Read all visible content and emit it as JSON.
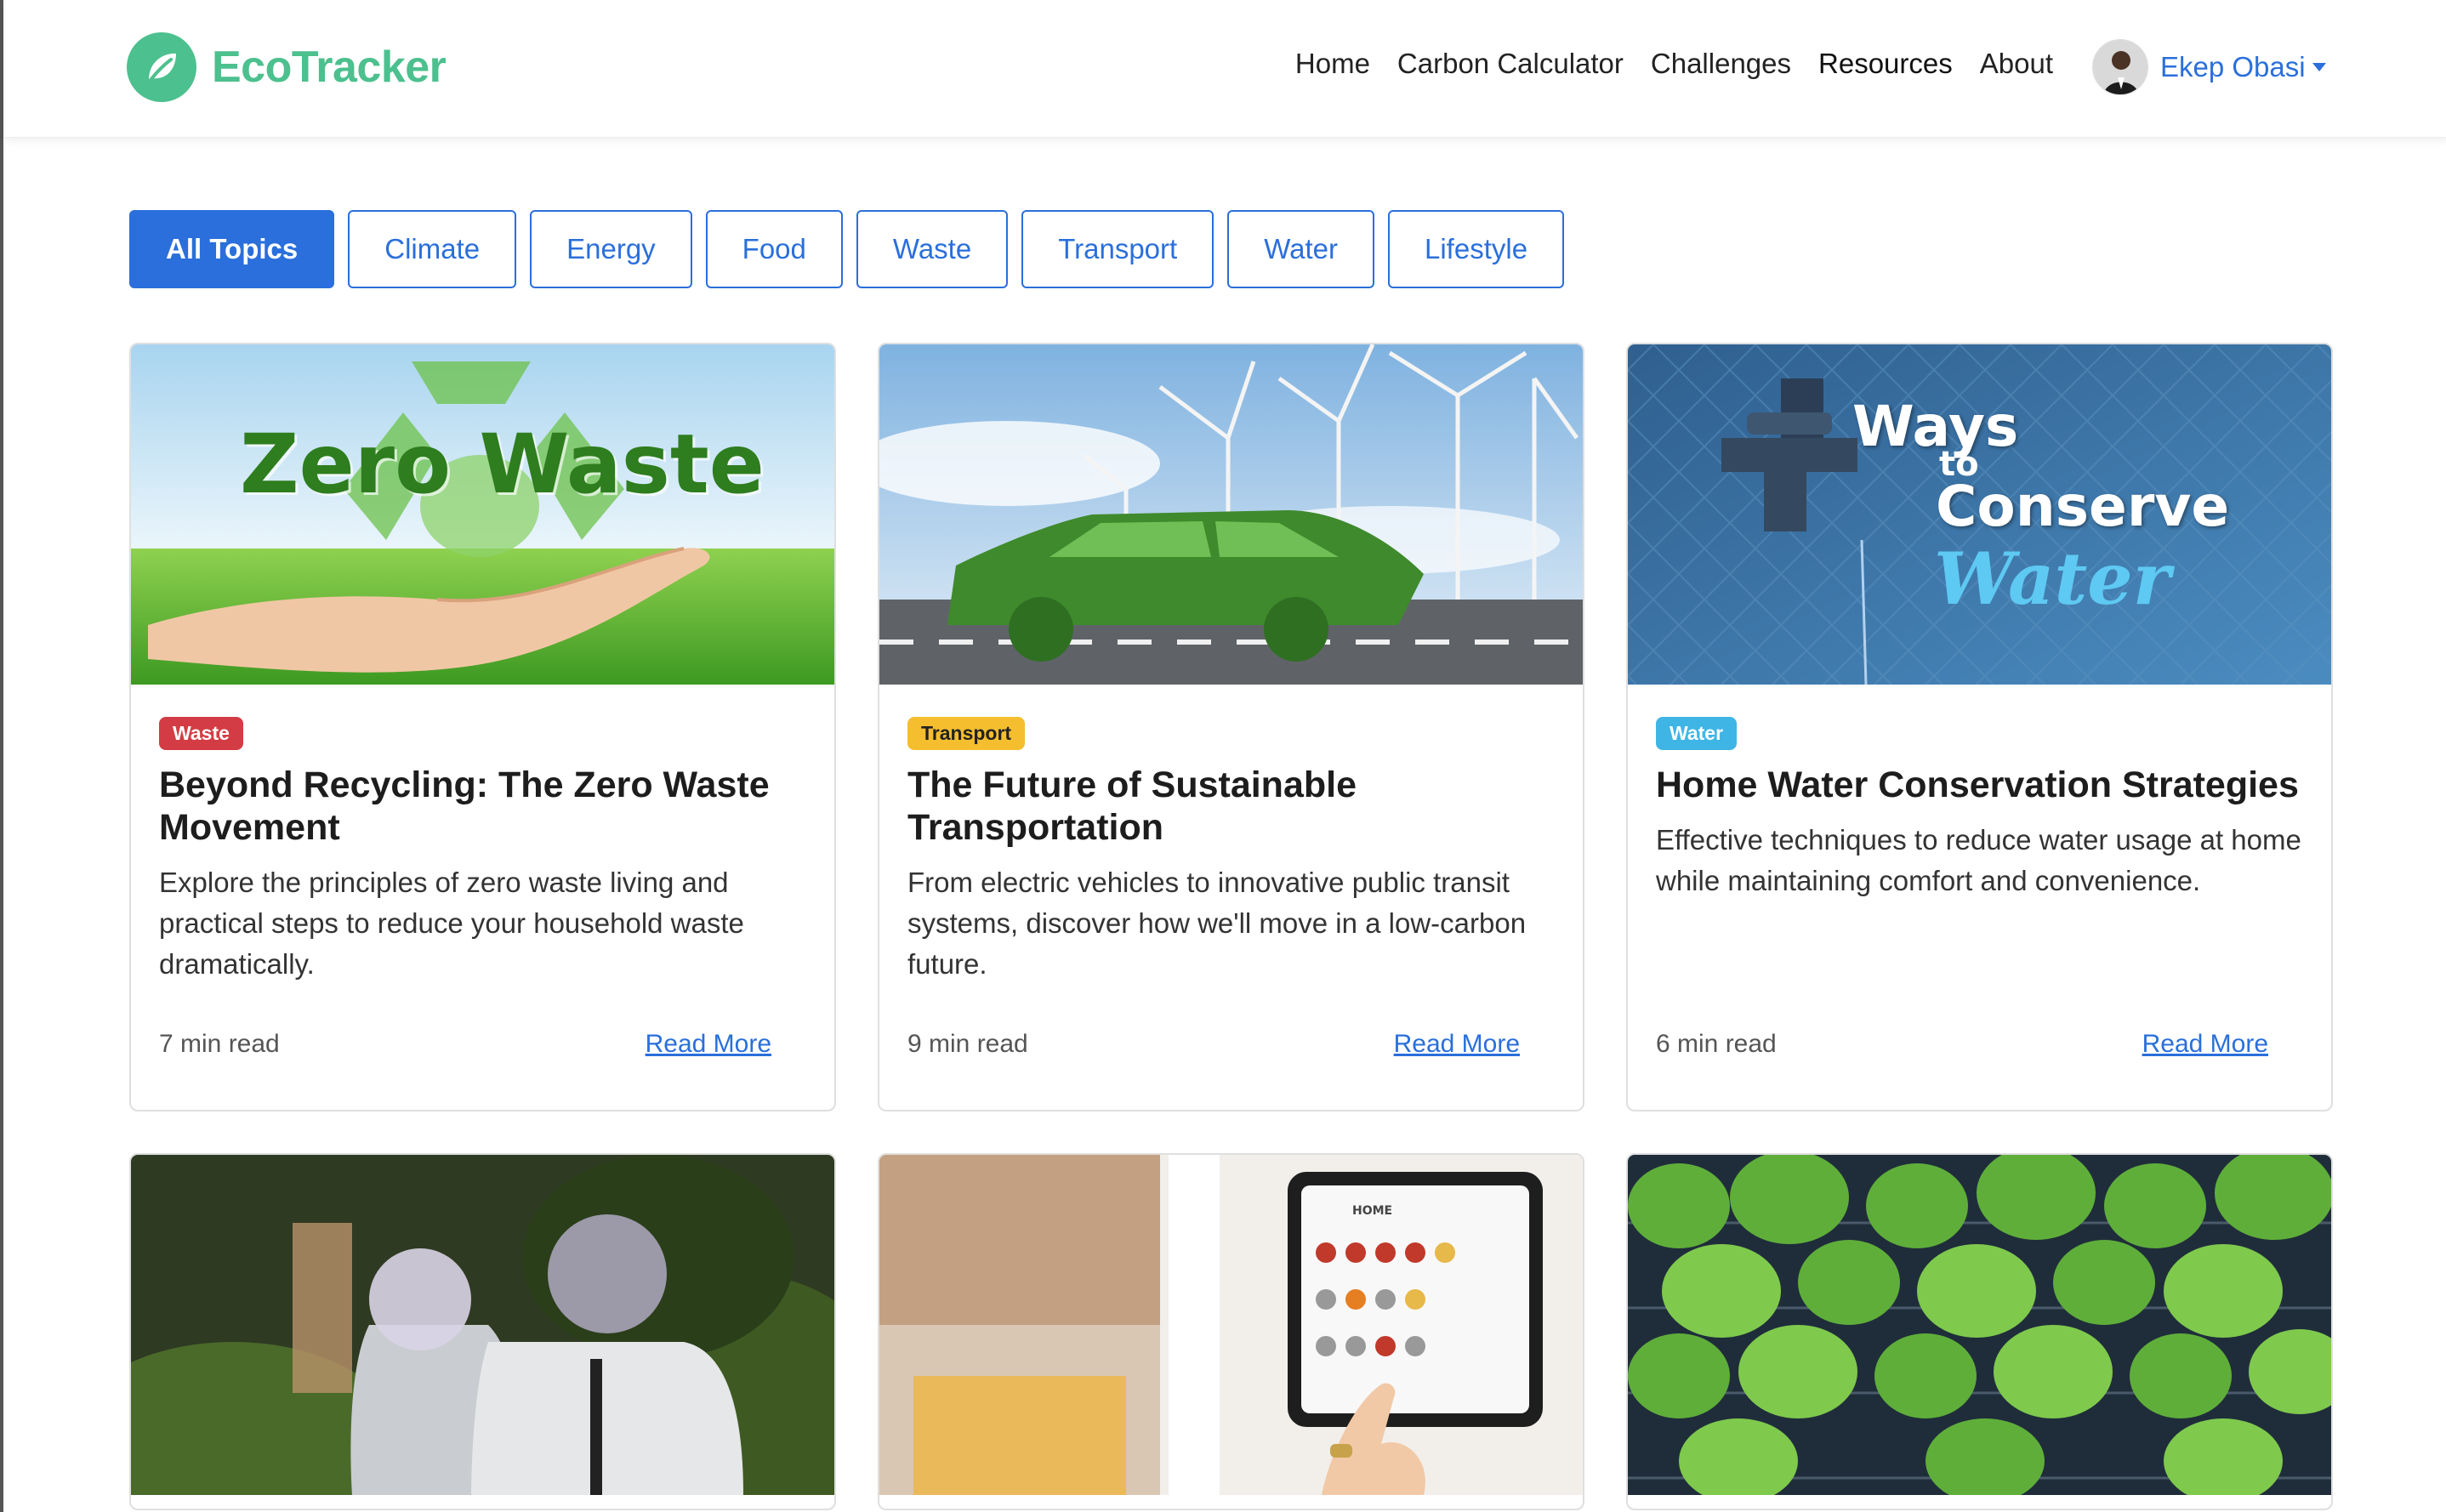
{
  "brand": {
    "name": "EcoTracker",
    "logo_icon": "leaf-icon",
    "color": "#4cc08e"
  },
  "nav": {
    "items": [
      {
        "label": "Home"
      },
      {
        "label": "Carbon Calculator"
      },
      {
        "label": "Challenges"
      },
      {
        "label": "Resources"
      },
      {
        "label": "About"
      }
    ],
    "active": "Resources"
  },
  "user": {
    "name": "Ekep Obasi"
  },
  "filters": {
    "items": [
      {
        "label": "All Topics"
      },
      {
        "label": "Climate"
      },
      {
        "label": "Energy"
      },
      {
        "label": "Food"
      },
      {
        "label": "Waste"
      },
      {
        "label": "Transport"
      },
      {
        "label": "Water"
      },
      {
        "label": "Lifestyle"
      }
    ],
    "active": "All Topics",
    "accent": "#2a6fdb"
  },
  "articles": [
    {
      "image_text": "Zero Waste",
      "category": "Waste",
      "category_color": "#d33c44",
      "title": "Beyond Recycling: The Zero Waste Movement",
      "description": "Explore the principles of zero waste living and practical steps to reduce your household waste dramatically.",
      "read_time": "7 min read",
      "link_label": "Read More"
    },
    {
      "category": "Transport",
      "category_color": "#f4be2f",
      "title": "The Future of Sustainable Transportation",
      "description": "From electric vehicles to innovative public transit systems, discover how we'll move in a low-carbon future.",
      "read_time": "9 min read",
      "link_label": "Read More"
    },
    {
      "image_text": {
        "line1": "Ways",
        "line2": "to",
        "line3": "Conserve",
        "line4": "Water"
      },
      "category": "Water",
      "category_color": "#3fb5e6",
      "title": "Home Water Conservation Strategies",
      "description": "Effective techniques to reduce water usage at home while maintaining comfort and convenience.",
      "read_time": "6 min read",
      "link_label": "Read More"
    }
  ],
  "tablet_text": "HOME"
}
